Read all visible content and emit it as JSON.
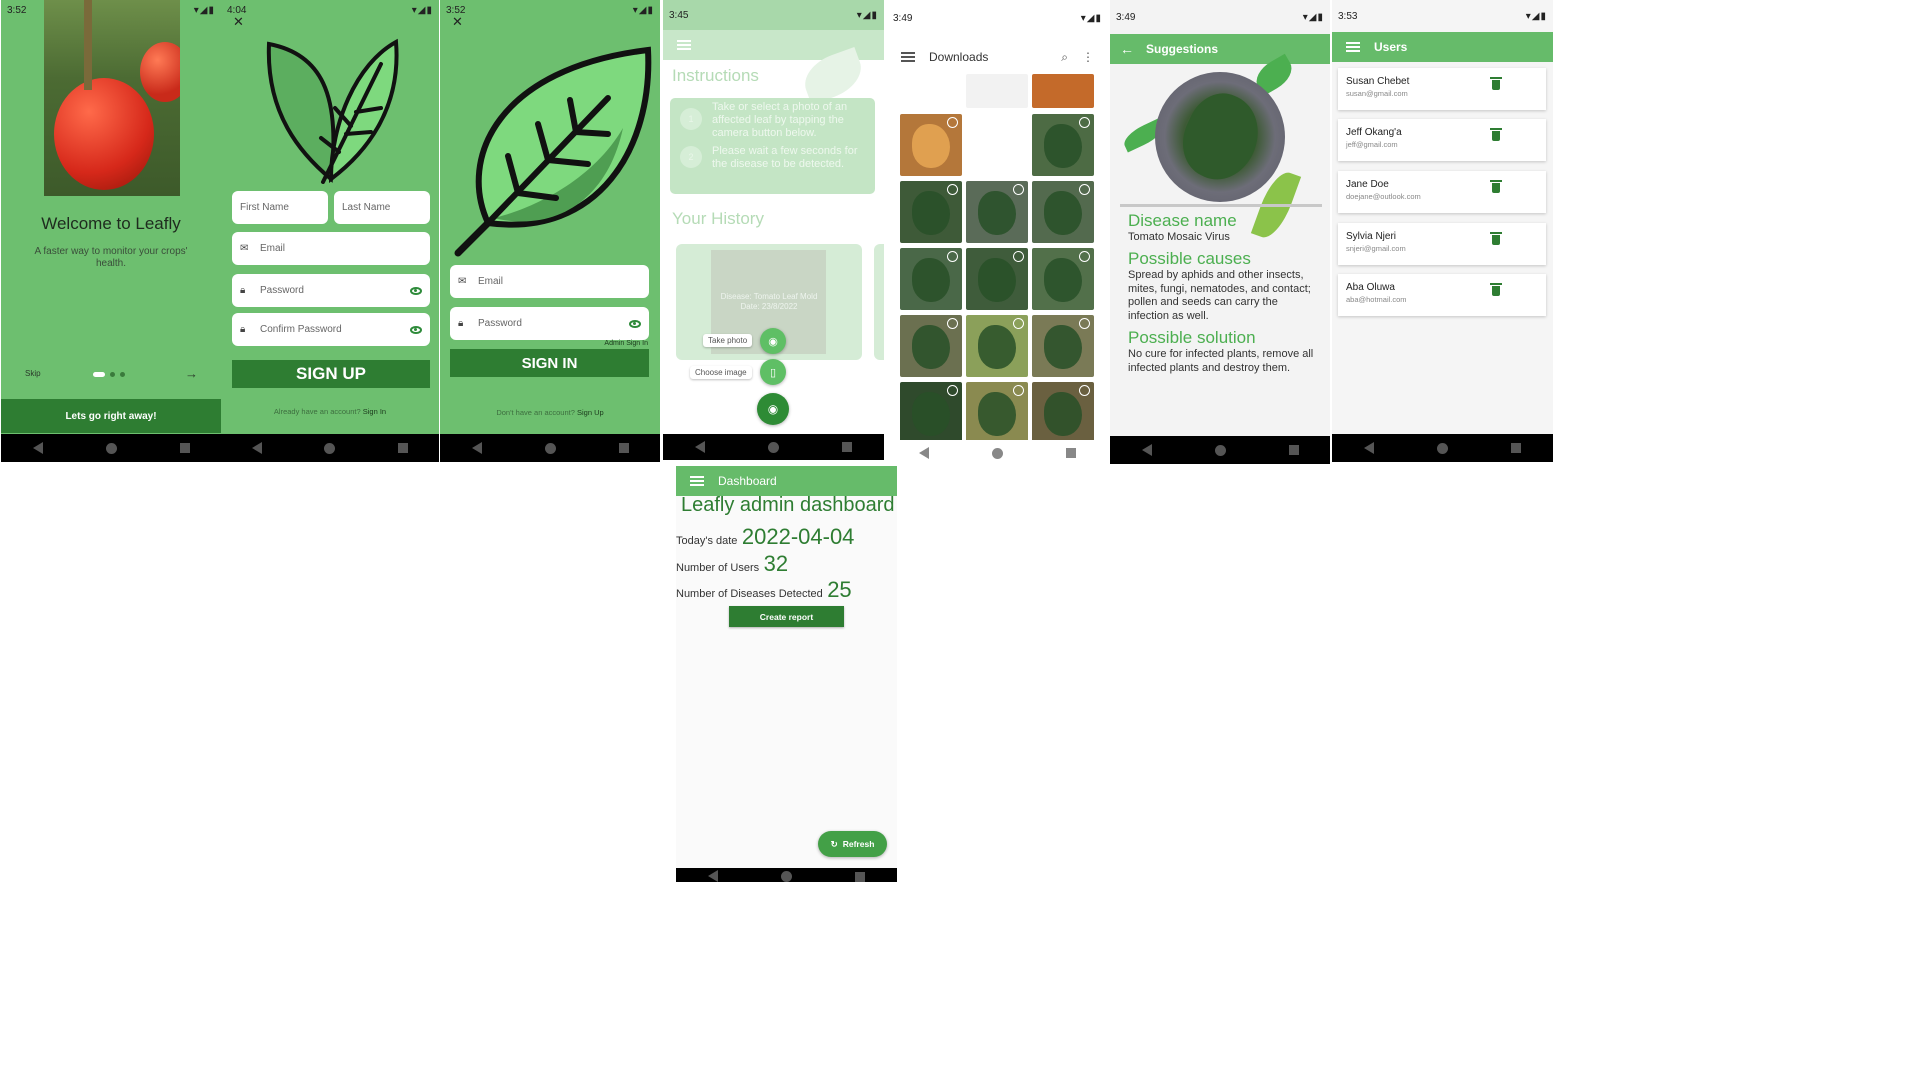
{
  "colors": {
    "primary": "#66bb6a",
    "dark": "#2e7d32",
    "screen": "#6dbf6f"
  },
  "onboarding": {
    "time": "3:52",
    "title": "Welcome to Leafly",
    "subtitle": "A faster way to monitor your crops' health.",
    "skip": "Skip",
    "cta": "Lets go right away!"
  },
  "signup": {
    "time": "4:04",
    "first_name": "First Name",
    "last_name": "Last Name",
    "email": "Email",
    "password": "Password",
    "confirm_password": "Confirm Password",
    "button": "SIGN UP",
    "footer_text": "Already have an account?",
    "footer_link": "Sign In"
  },
  "signin": {
    "time": "3:52",
    "email": "Email",
    "password": "Password",
    "admin_link": "Admin Sign In",
    "button": "SIGN IN",
    "footer_text": "Don't have an account?",
    "footer_link": "Sign Up"
  },
  "home": {
    "time": "3:45",
    "instructions_title": "Instructions",
    "step1_num": "1",
    "step1": "Take or select a photo of an affected leaf by tapping the camera button below.",
    "step2_num": "2",
    "step2": "Please wait a few seconds for the disease to be detected.",
    "history_title": "Your History",
    "history_card": "Disease: Tomato Leaf Mold",
    "history_date": "Date: 23/8/2022",
    "take_photo": "Take photo",
    "choose_image": "Choose image"
  },
  "dashboard": {
    "appbar": "Dashboard",
    "title": "Leafly admin dashboard",
    "date_label": "Today's date",
    "date_value": "2022-04-04",
    "users_label": "Number of Users",
    "users_value": "32",
    "diseases_label": "Number of Diseases Detected",
    "diseases_value": "25",
    "report_button": "Create report",
    "refresh_button": "Refresh"
  },
  "downloads": {
    "time": "3:49",
    "title": "Downloads"
  },
  "suggestions": {
    "time": "3:49",
    "appbar": "Suggestions",
    "disease_heading": "Disease name",
    "disease_value": "Tomato Mosaic Virus",
    "causes_heading": "Possible causes",
    "causes_value": "Spread by aphids and other insects, mites, fungi, nematodes, and contact; pollen and seeds can carry the infection as well.",
    "solution_heading": "Possible solution",
    "solution_value": "No cure for infected plants, remove all infected plants and destroy them."
  },
  "users": {
    "time": "3:53",
    "appbar": "Users",
    "list": [
      {
        "name": "Susan Chebet",
        "email": "susan@gmail.com"
      },
      {
        "name": "Jeff Okang'a",
        "email": "jeff@gmail.com"
      },
      {
        "name": "Jane Doe",
        "email": "doejane@outlook.com"
      },
      {
        "name": "Sylvia Njeri",
        "email": "snjeri@gmail.com"
      },
      {
        "name": "Aba Oluwa",
        "email": "aba@hotmail.com"
      }
    ]
  }
}
